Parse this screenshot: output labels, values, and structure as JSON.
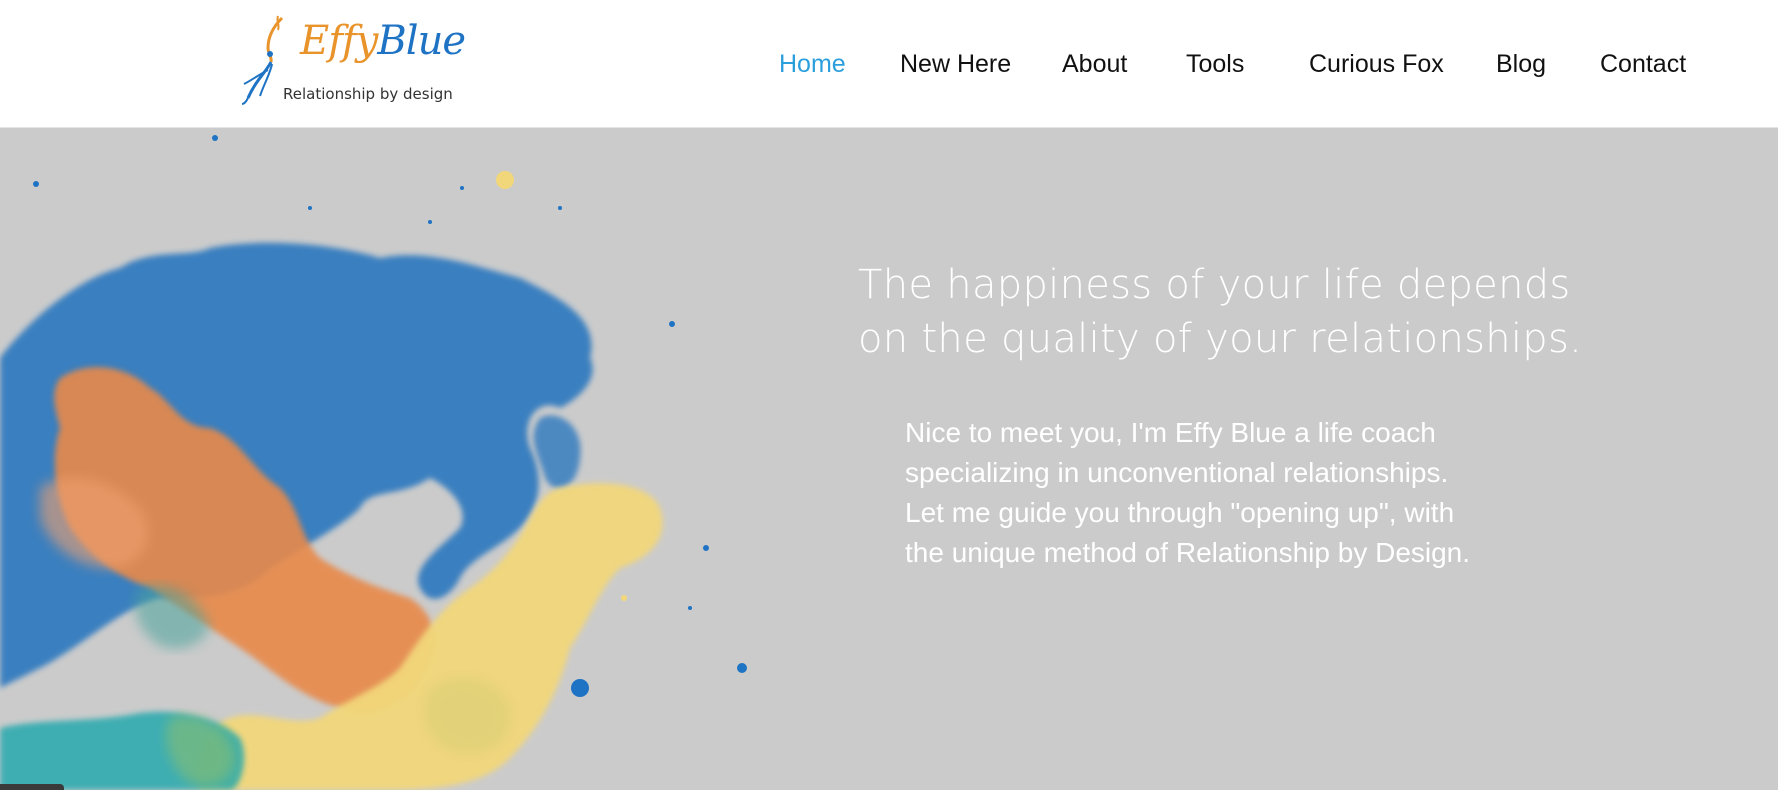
{
  "brand": {
    "name_part1": "Effy",
    "name_part2": "Blue",
    "tagline": "Relationship by design",
    "colors": {
      "orange": "#e9932b",
      "blue": "#1f73c4",
      "nav_active": "#2b9fdc",
      "hero_background": "#cbcbcb"
    }
  },
  "nav": {
    "items": [
      {
        "label": "Home",
        "active": true
      },
      {
        "label": "New Here",
        "active": false
      },
      {
        "label": "About",
        "active": false
      },
      {
        "label": "Tools",
        "active": false
      },
      {
        "label": "Curious Fox",
        "active": false
      },
      {
        "label": "Blog",
        "active": false
      },
      {
        "label": "Contact",
        "active": false
      }
    ]
  },
  "hero": {
    "headline_line1": "The happiness of your life depends",
    "headline_line2": "on the quality of your relationships.",
    "intro_line1": "Nice to meet you, I'm Effy Blue a life coach",
    "intro_line2": "specializing in unconventional relationships.",
    "intro_line3": "Let me guide you through \"opening up\", with",
    "intro_line4": "the unique method of Relationship by Design.",
    "image": "watercolor-splash"
  }
}
